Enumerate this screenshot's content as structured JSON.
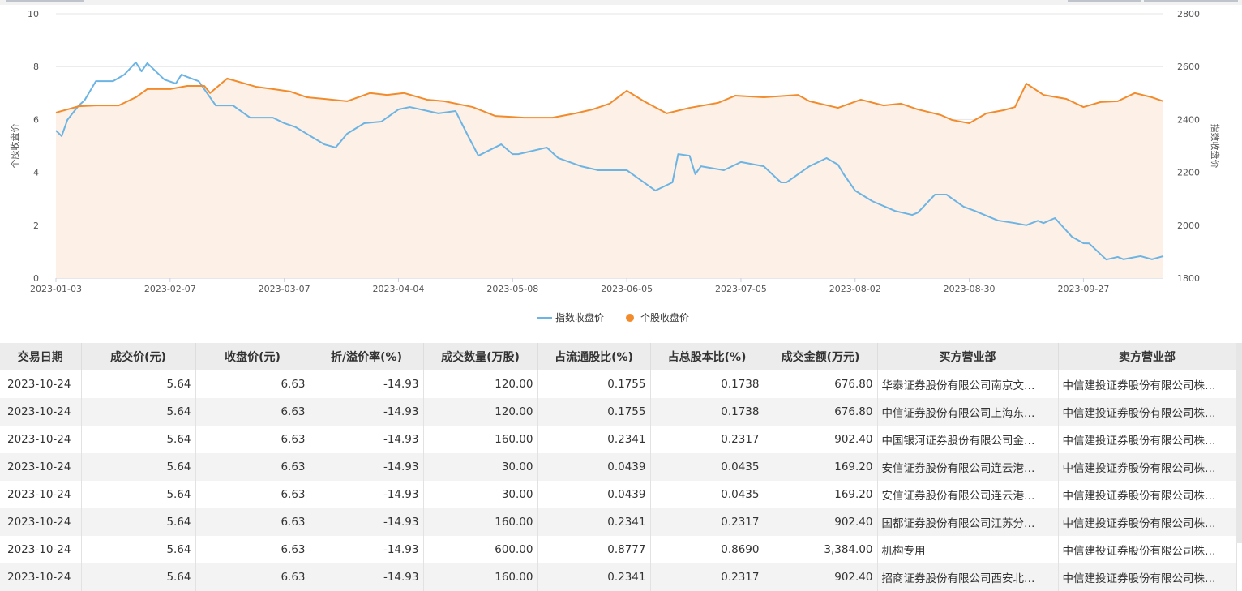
{
  "chart_data": {
    "type": "line",
    "x_ticks": [
      "2023-01-03",
      "2023-02-07",
      "2023-03-07",
      "2023-04-04",
      "2023-05-08",
      "2023-06-05",
      "2023-07-05",
      "2023-08-02",
      "2023-08-30",
      "2023-09-27"
    ],
    "x_unit": "trading-day index (ticks every 20 days)",
    "x_range": [
      0,
      194
    ],
    "left_axis": {
      "label": "个股收盘价",
      "range": [
        0,
        10
      ],
      "ticks": [
        "0",
        "2",
        "4",
        "6",
        "8",
        "10"
      ]
    },
    "right_axis": {
      "label": "指数收盘价",
      "range": [
        1800,
        2800
      ],
      "ticks": [
        "1800",
        "2000",
        "2200",
        "2400",
        "2600",
        "2800"
      ]
    },
    "grid": true,
    "legend_position": "bottom",
    "series": [
      {
        "name": "指数收盘价",
        "axis": "right",
        "color": "#6cb4e4",
        "x": [
          0,
          1,
          2,
          4,
          5,
          7,
          10,
          12,
          14,
          15,
          16,
          19,
          21,
          22,
          23,
          25,
          28,
          31,
          34,
          38,
          40,
          42,
          47,
          49,
          51,
          54,
          57,
          60,
          62,
          67,
          70,
          72,
          74,
          78,
          80,
          81,
          86,
          88,
          92,
          95,
          100,
          105,
          108,
          109,
          111,
          112,
          113,
          117,
          120,
          124,
          127,
          128,
          132,
          135,
          137,
          138,
          140,
          143,
          147,
          150,
          151,
          154,
          156,
          159,
          161,
          165,
          168,
          170,
          172,
          173,
          175,
          178,
          180,
          181,
          184,
          186,
          187,
          190,
          192,
          194
        ],
        "y": [
          2358,
          2337,
          2398,
          2453,
          2472,
          2545,
          2545,
          2570,
          2616,
          2582,
          2613,
          2551,
          2536,
          2570,
          2561,
          2545,
          2453,
          2453,
          2407,
          2407,
          2386,
          2371,
          2306,
          2294,
          2346,
          2386,
          2392,
          2438,
          2447,
          2423,
          2432,
          2346,
          2263,
          2306,
          2269,
          2269,
          2294,
          2254,
          2223,
          2208,
          2208,
          2131,
          2162,
          2269,
          2263,
          2193,
          2223,
          2208,
          2239,
          2223,
          2162,
          2162,
          2223,
          2254,
          2229,
          2193,
          2131,
          2091,
          2054,
          2039,
          2048,
          2116,
          2116,
          2070,
          2054,
          2018,
          2008,
          2000,
          2017,
          2008,
          2027,
          1956,
          1932,
          1931,
          1870,
          1880,
          1871,
          1883,
          1871,
          1883
        ]
      },
      {
        "name": "个股收盘价",
        "axis": "left",
        "color": "#f28b2c",
        "x": [
          0,
          4,
          7,
          11,
          14,
          16,
          20,
          23,
          26,
          27,
          30,
          35,
          38,
          41,
          44,
          47,
          51,
          55,
          58,
          61,
          65,
          68,
          73,
          77,
          82,
          87,
          91,
          94,
          97,
          100,
          103,
          107,
          111,
          116,
          119,
          124,
          130,
          132,
          137,
          141,
          145,
          148,
          151,
          155,
          157,
          160,
          163,
          166,
          168,
          170,
          173,
          177,
          180,
          183,
          186,
          189,
          192,
          194
        ],
        "y": [
          6.26,
          6.5,
          6.53,
          6.53,
          6.84,
          7.15,
          7.15,
          7.27,
          7.27,
          7.0,
          7.55,
          7.24,
          7.15,
          7.06,
          6.84,
          6.78,
          6.69,
          7.0,
          6.93,
          7.0,
          6.75,
          6.69,
          6.47,
          6.13,
          6.07,
          6.07,
          6.23,
          6.38,
          6.6,
          7.09,
          6.69,
          6.23,
          6.44,
          6.63,
          6.9,
          6.84,
          6.93,
          6.69,
          6.44,
          6.75,
          6.53,
          6.6,
          6.38,
          6.17,
          5.98,
          5.86,
          6.23,
          6.35,
          6.47,
          7.36,
          6.93,
          6.78,
          6.47,
          6.66,
          6.69,
          7.0,
          6.84,
          6.69
        ]
      }
    ]
  },
  "table": {
    "headers": [
      "交易日期",
      "成交价(元)",
      "收盘价(元)",
      "折/溢价率(%)",
      "成交数量(万股)",
      "占流通股比(%)",
      "占总股本比(%)",
      "成交金额(万元)",
      "买方营业部",
      "卖方营业部"
    ],
    "rows": [
      [
        "2023-10-24",
        "5.64",
        "6.63",
        "-14.93",
        "120.00",
        "0.1755",
        "0.1738",
        "676.80",
        "华泰证券股份有限公司南京文…",
        "中信建投证券股份有限公司株…"
      ],
      [
        "2023-10-24",
        "5.64",
        "6.63",
        "-14.93",
        "120.00",
        "0.1755",
        "0.1738",
        "676.80",
        "中信证券股份有限公司上海东…",
        "中信建投证券股份有限公司株…"
      ],
      [
        "2023-10-24",
        "5.64",
        "6.63",
        "-14.93",
        "160.00",
        "0.2341",
        "0.2317",
        "902.40",
        "中国银河证券股份有限公司金…",
        "中信建投证券股份有限公司株…"
      ],
      [
        "2023-10-24",
        "5.64",
        "6.63",
        "-14.93",
        "30.00",
        "0.0439",
        "0.0435",
        "169.20",
        "安信证券股份有限公司连云港…",
        "中信建投证券股份有限公司株…"
      ],
      [
        "2023-10-24",
        "5.64",
        "6.63",
        "-14.93",
        "30.00",
        "0.0439",
        "0.0435",
        "169.20",
        "安信证券股份有限公司连云港…",
        "中信建投证券股份有限公司株…"
      ],
      [
        "2023-10-24",
        "5.64",
        "6.63",
        "-14.93",
        "160.00",
        "0.2341",
        "0.2317",
        "902.40",
        "国都证券股份有限公司江苏分…",
        "中信建投证券股份有限公司株…"
      ],
      [
        "2023-10-24",
        "5.64",
        "6.63",
        "-14.93",
        "600.00",
        "0.8777",
        "0.8690",
        "3,384.00",
        "机构专用",
        "中信建投证券股份有限公司株…"
      ],
      [
        "2023-10-24",
        "5.64",
        "6.63",
        "-14.93",
        "160.00",
        "0.2341",
        "0.2317",
        "902.40",
        "招商证券股份有限公司西安北…",
        "中信建投证券股份有限公司株…"
      ]
    ]
  }
}
